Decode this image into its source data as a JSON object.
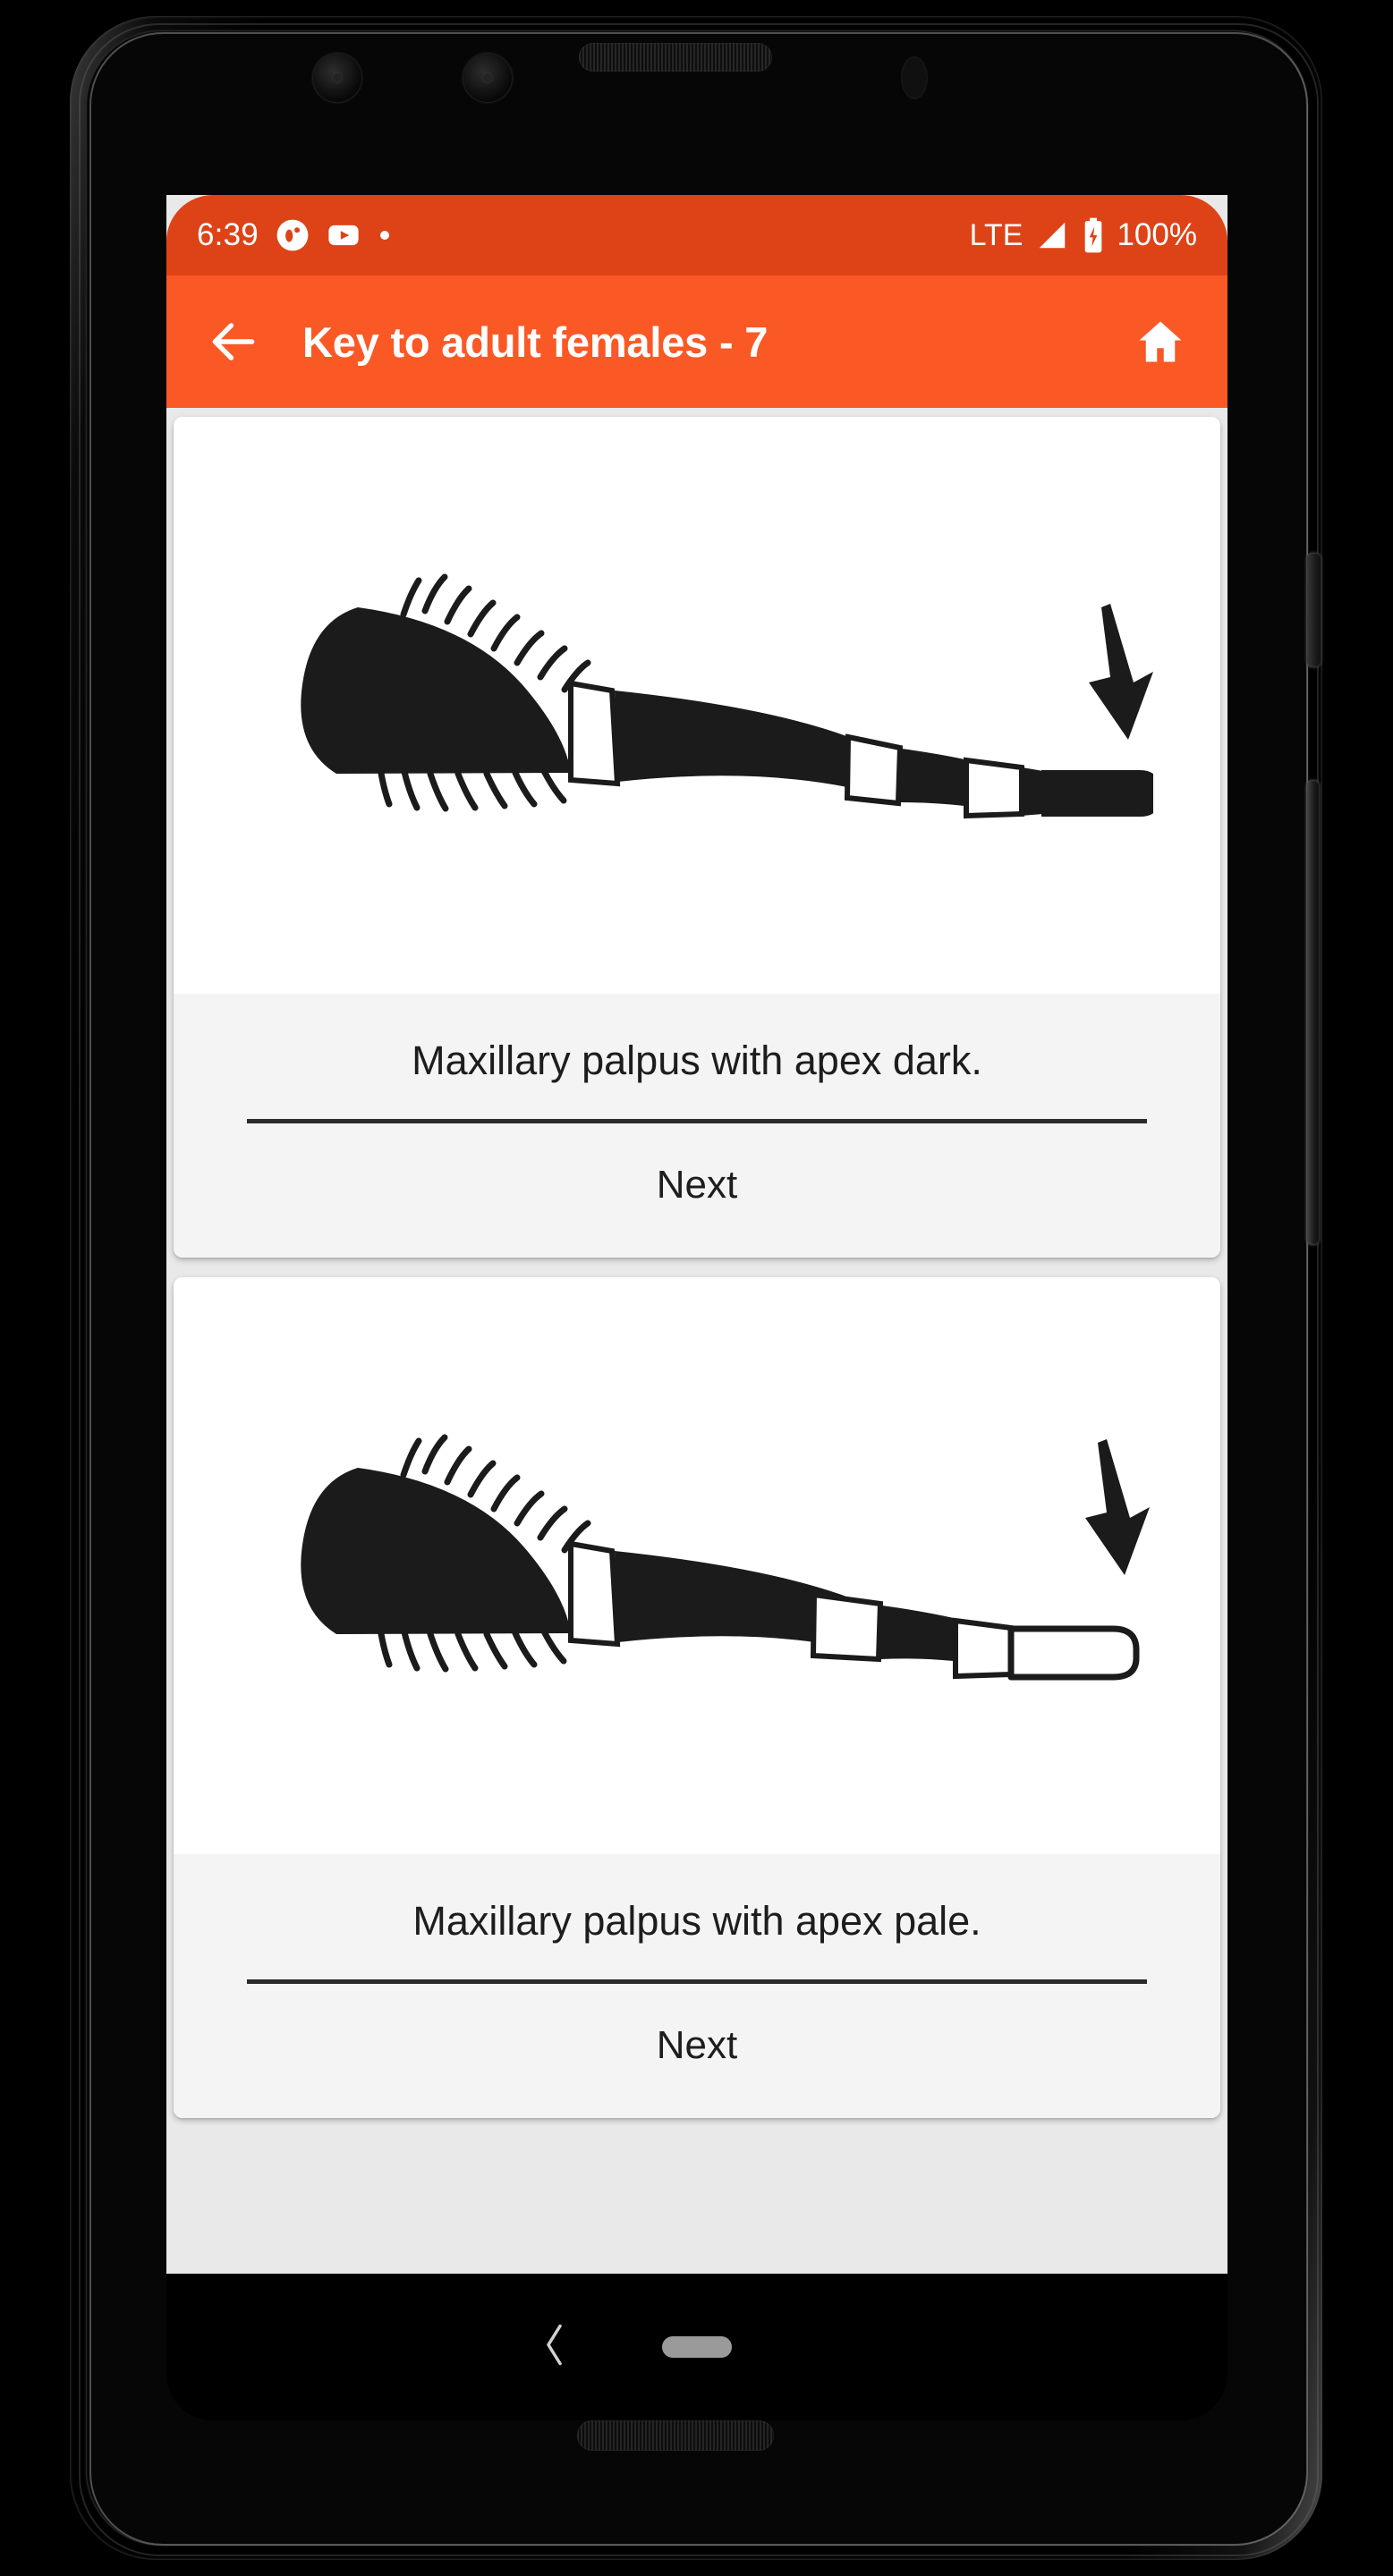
{
  "status_bar": {
    "clock": "6:39",
    "battery_percent": "100%",
    "network_type": "LTE",
    "icons": [
      "app-circle-icon",
      "youtube-icon",
      "notification-dot-icon",
      "signal-icon",
      "battery-charging-icon"
    ],
    "background_color": "#DD4317"
  },
  "app_bar": {
    "title": "Key to adult females - 7",
    "back_icon": "back-arrow-icon",
    "home_icon": "home-icon",
    "background_color": "#FA5825",
    "text_color": "#FFFFFF"
  },
  "content": {
    "background_color": "#E9E9E9",
    "cards": [
      {
        "illustration": "maxillary-palpus-dark-apex-diagram",
        "apex_style": "dark",
        "caption": "Maxillary palpus with apex dark.",
        "next_label": "Next"
      },
      {
        "illustration": "maxillary-palpus-pale-apex-diagram",
        "apex_style": "pale",
        "caption": "Maxillary palpus with apex pale.",
        "next_label": "Next"
      }
    ]
  },
  "nav_bar": {
    "back_icon": "nav-back-chevron-icon",
    "home_icon": "nav-home-pill-icon",
    "background_color": "#000000"
  }
}
